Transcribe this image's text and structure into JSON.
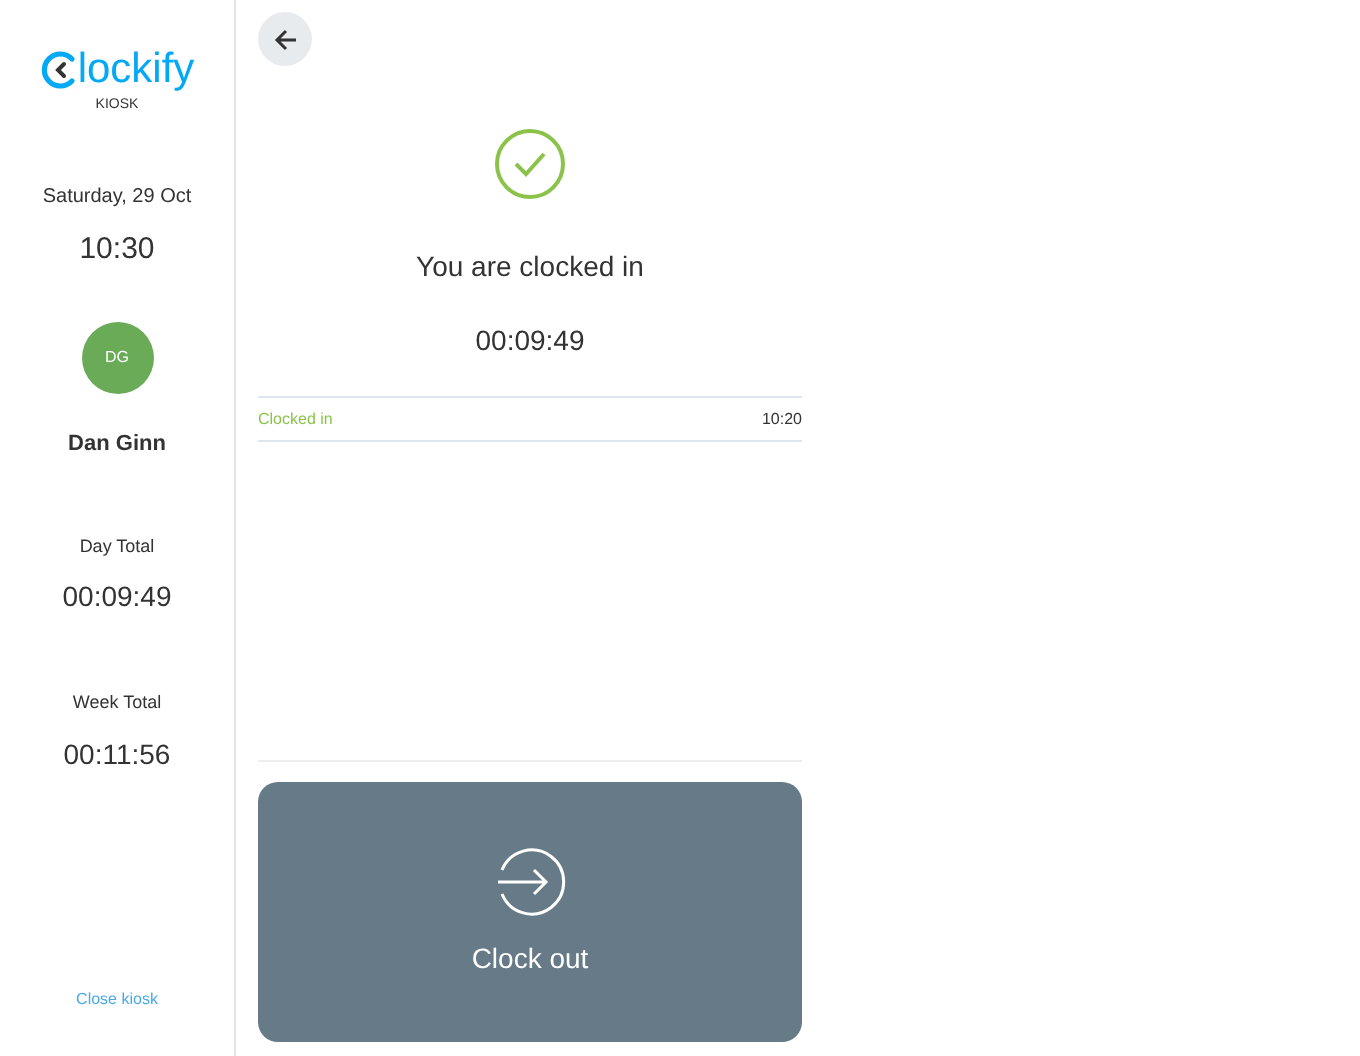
{
  "sidebar": {
    "logo_text": "lockify",
    "subtitle": "KIOSK",
    "date": "Saturday, 29 Oct",
    "time": "10:30",
    "user": {
      "initials": "DG",
      "name": "Dan Ginn",
      "color": "#6aab57"
    },
    "totals": [
      {
        "label": "Day Total",
        "value": "00:09:49"
      },
      {
        "label": "Week Total",
        "value": "00:11:56"
      }
    ],
    "close_link": "Close kiosk"
  },
  "main": {
    "status": "You are clocked in",
    "timer": "00:09:49",
    "entries": [
      {
        "label": "Clocked in",
        "time": "10:20"
      }
    ],
    "action": {
      "label": "Clock out"
    }
  }
}
